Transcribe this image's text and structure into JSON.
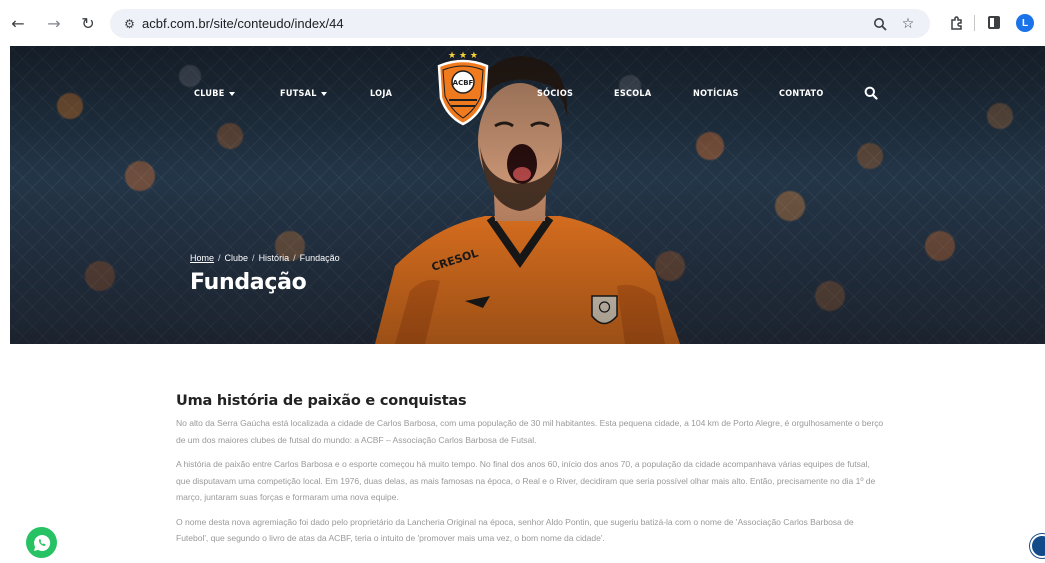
{
  "browser": {
    "url": "acbf.com.br/site/conteudo/index/44",
    "profile_initial": "L",
    "icons": [
      "back-arrow-icon",
      "forward-arrow-icon",
      "reload-icon",
      "site-settings-icon",
      "zoom-icon",
      "bookmark-star-icon",
      "extensions-icon",
      "side-panel-icon"
    ]
  },
  "nav": {
    "items": [
      {
        "label": "CLUBE",
        "dropdown": true
      },
      {
        "label": "FUTSAL",
        "dropdown": true
      },
      {
        "label": "LOJA",
        "dropdown": false
      },
      {
        "label": "SÓCIOS",
        "dropdown": false
      },
      {
        "label": "ESCOLA",
        "dropdown": false
      },
      {
        "label": "NOTÍCIAS",
        "dropdown": false
      },
      {
        "label": "CONTATO",
        "dropdown": false
      }
    ],
    "crest_initials": "ACBF"
  },
  "hero": {
    "breadcrumb": [
      "Home",
      "Clube",
      "História",
      "Fundação"
    ],
    "title": "Fundação"
  },
  "content": {
    "heading": "Uma história de paixão e conquistas",
    "paragraphs": [
      "No alto da Serra Gaúcha está localizada a cidade de Carlos Barbosa, com uma população de 30 mil habitantes. Esta pequena cidade, a 104 km de Porto Alegre, é orgulhosamente o berço de um dos maiores clubes de futsal do mundo: a ACBF – Associação Carlos Barbosa de Futsal.",
      "A história de paixão entre Carlos Barbosa e o esporte começou há muito tempo. No final dos anos 60, início dos anos 70, a população da cidade acompanhava várias equipes de futsal, que disputavam uma competição local. Em 1976, duas delas, as mais famosas na época, o Real e o River, decidiram que seria possível olhar mais alto. Então, precisamente no dia 1º de março, juntaram suas forças e formaram uma nova equipe.",
      "O nome desta nova agremiação foi dado pelo proprietário da Lancheria Original na época, senhor Aldo Pontin, que sugeriu batizá-la com o nome de 'Associação Carlos Barbosa de Futebol', que segundo o livro de atas da ACBF, teria o intuito de 'promover mais uma vez, o bom nome da cidade'."
    ]
  },
  "colors": {
    "brand_orange": "#f07a1e",
    "whatsapp_green": "#27c264",
    "text_gray": "#9a9a9a"
  }
}
